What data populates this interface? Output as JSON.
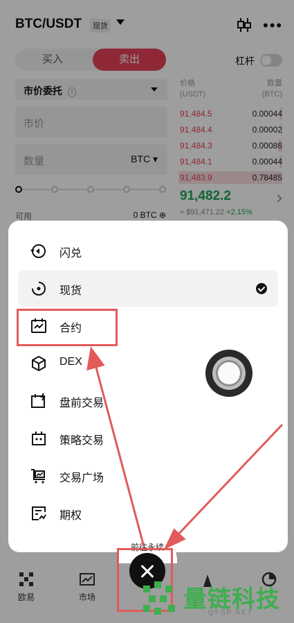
{
  "header": {
    "pair": "BTC/USDT",
    "market_tag": "现货"
  },
  "trade": {
    "buy_tab": "买入",
    "sell_tab": "卖出",
    "leverage_label": "杠杆",
    "leverage_on": false,
    "order_type": "市价委托",
    "price_placeholder": "市价",
    "qty_placeholder": "数量",
    "qty_unit": "BTC",
    "slider_percent": 0,
    "available_label": "可用",
    "available_value": "0 BTC"
  },
  "orderbook": {
    "price_header": "价格",
    "price_unit": "(USDT)",
    "qty_header": "数量",
    "qty_unit": "(BTC)",
    "asks": [
      {
        "price": "91,484.5",
        "qty": "0.00044"
      },
      {
        "price": "91,484.4",
        "qty": "0.00002"
      },
      {
        "price": "91,484.3",
        "qty": "0.00086"
      },
      {
        "price": "91,484.1",
        "qty": "0.00044"
      },
      {
        "price": "91,483.9",
        "qty": "0.78485"
      }
    ],
    "last_price": "91,482.2",
    "ref_price": "≈ $91,471.22",
    "change": "+2.15%"
  },
  "menu": {
    "items": [
      {
        "label": "闪兑",
        "icon": "swap-icon",
        "selected": false
      },
      {
        "label": "现货",
        "icon": "spot-icon",
        "selected": true
      },
      {
        "label": "合约",
        "icon": "contract-icon",
        "selected": false
      },
      {
        "label": "DEX",
        "icon": "cube-icon",
        "selected": false
      },
      {
        "label": "盘前交易",
        "icon": "premarket-icon",
        "selected": false
      },
      {
        "label": "策略交易",
        "icon": "bot-icon",
        "selected": false
      },
      {
        "label": "交易广场",
        "icon": "cart-icon",
        "selected": false
      },
      {
        "label": "期权",
        "icon": "options-icon",
        "selected": false
      }
    ],
    "goto_label": "前往永续"
  },
  "nav": {
    "items": [
      {
        "label": "欧易",
        "icon": "okx-logo-icon"
      },
      {
        "label": "市场",
        "icon": "market-chart-icon"
      }
    ]
  },
  "watermark": {
    "title": "量链科技",
    "site": "QFSP.NET"
  },
  "colors": {
    "sell": "#e5425a",
    "buy": "#20a35a",
    "highlight": "#e25a5a",
    "watermark": "#3fae4f"
  }
}
